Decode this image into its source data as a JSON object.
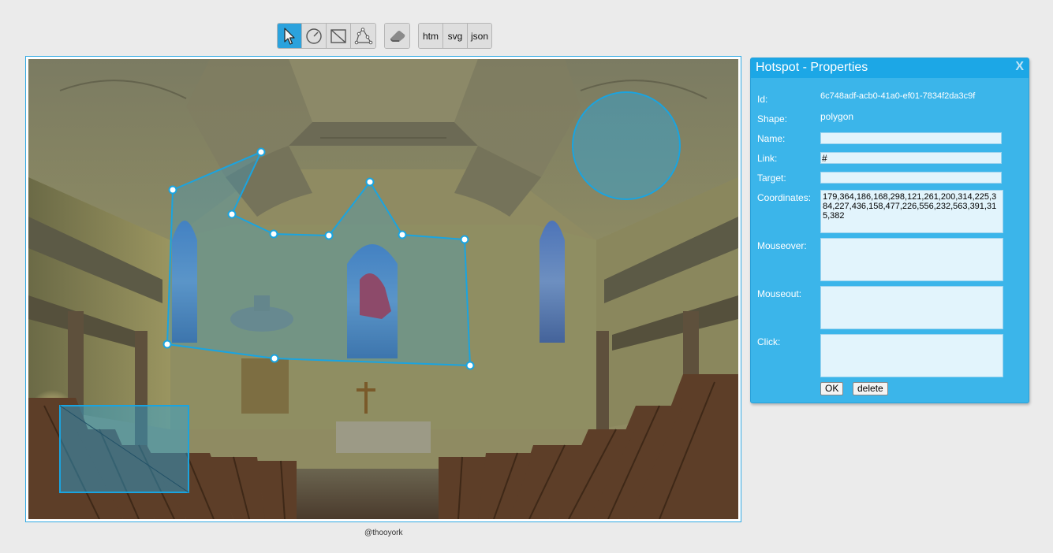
{
  "toolbar": {
    "tools": [
      {
        "name": "select-tool",
        "icon": "cursor-arrow",
        "active": true
      },
      {
        "name": "circle-tool",
        "icon": "circle-draw"
      },
      {
        "name": "rectangle-tool",
        "icon": "rectangle-draw"
      },
      {
        "name": "polygon-tool",
        "icon": "polygon-draw"
      }
    ],
    "eraser_icon": "eraser",
    "export": {
      "htm": "htm",
      "svg": "svg",
      "json": "json"
    }
  },
  "credit": "@thooyork",
  "panel": {
    "title": "Hotspot - Properties",
    "close_label": "X",
    "labels": {
      "id": "Id:",
      "shape": "Shape:",
      "name": "Name:",
      "link": "Link:",
      "target": "Target:",
      "coordinates": "Coordinates:",
      "mouseover": "Mouseover:",
      "mouseout": "Mouseout:",
      "click": "Click:"
    },
    "values": {
      "id": "6c748adf-acb0-41a0-ef01-7834f2da3c9f",
      "shape": "polygon",
      "name": "",
      "link": "#",
      "target": "",
      "coordinates": "179,364,186,168,298,121,261,200,314,225,384,227,436,158,477,226,556,232,563,391,315,382",
      "mouseover": "",
      "mouseout": "",
      "click": ""
    },
    "buttons": {
      "ok": "OK",
      "delete": "delete"
    }
  },
  "colors": {
    "accent": "#2ba2dd",
    "panel": "#3bb5ea",
    "hotspot_stroke": "#1aa4e0",
    "hotspot_fill": "#2aa6dd"
  }
}
